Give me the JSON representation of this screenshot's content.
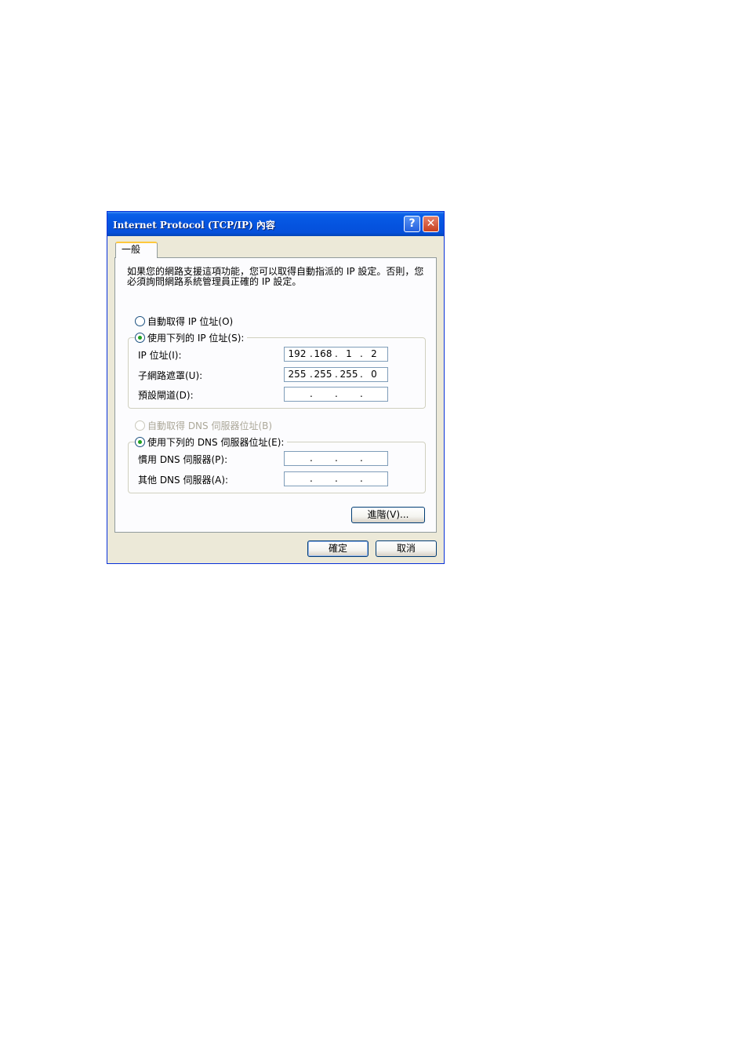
{
  "window": {
    "title": "Internet Protocol (TCP/IP) 內容",
    "help_glyph": "?",
    "close_glyph": "✕"
  },
  "tabs": [
    {
      "label": "一般",
      "selected": true
    }
  ],
  "description": "如果您的網路支援這項功能，您可以取得自動指派的 IP 設定。否則，您必須詢問網路系統管理員正確的 IP 設定。",
  "ip_section": {
    "auto_radio": {
      "label": "自動取得 IP 位址(O)",
      "checked": false
    },
    "manual_radio": {
      "label": "使用下列的 IP 位址(S):",
      "checked": true
    },
    "fields": [
      {
        "label": "IP 位址(I):",
        "octets": [
          "192",
          "168",
          "1",
          "2"
        ]
      },
      {
        "label": "子網路遮罩(U):",
        "octets": [
          "255",
          "255",
          "255",
          "0"
        ]
      },
      {
        "label": "預設閘道(D):",
        "octets": [
          "",
          "",
          "",
          ""
        ]
      }
    ]
  },
  "dns_section": {
    "auto_radio": {
      "label": "自動取得 DNS 伺服器位址(B)",
      "checked": false,
      "disabled": true
    },
    "manual_radio": {
      "label": "使用下列的 DNS 伺服器位址(E):",
      "checked": true
    },
    "fields": [
      {
        "label": "慣用 DNS 伺服器(P):",
        "octets": [
          "",
          "",
          "",
          ""
        ]
      },
      {
        "label": "其他 DNS 伺服器(A):",
        "octets": [
          "",
          "",
          "",
          ""
        ]
      }
    ]
  },
  "buttons": {
    "advanced": "進階(V)...",
    "ok": "確定",
    "cancel": "取消"
  },
  "colors": {
    "titlebar": "#0554e0",
    "dialog_bg": "#ece9d8",
    "tab_highlight": "#ffc83c",
    "radio_dot": "#21a121"
  }
}
